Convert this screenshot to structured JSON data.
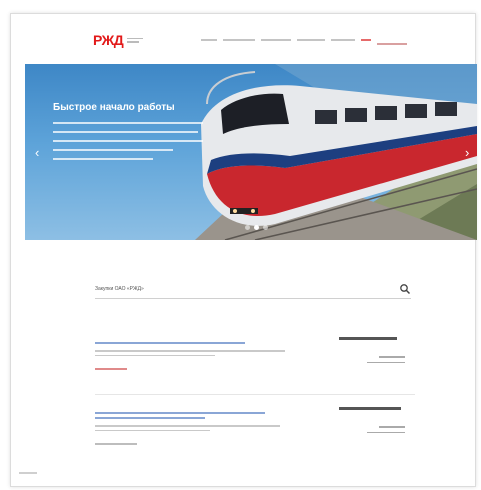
{
  "colors": {
    "brand_red": "#e21a1a",
    "link_blue": "#1f4ea3",
    "hero_blue": "#3e87c6",
    "caption_blue": "#1d3f8c"
  },
  "header": {
    "logo": "РЖД"
  },
  "hero": {
    "title": "Быстрое начало работы",
    "active_slide": 1,
    "slide_count": 3,
    "prev_icon": "chevron-left-icon",
    "next_icon": "chevron-right-icon"
  },
  "search": {
    "label": "Закупки ОАО «РЖД»",
    "icon": "search-icon"
  }
}
